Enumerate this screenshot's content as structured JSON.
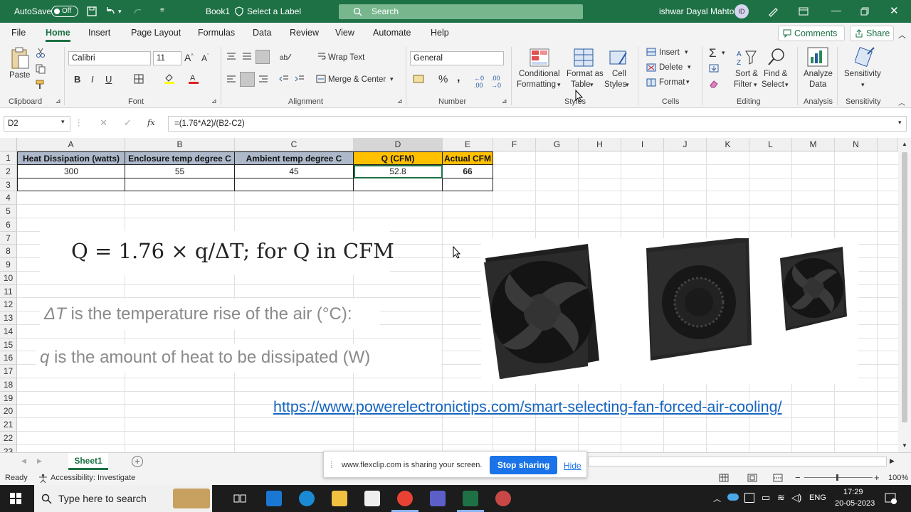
{
  "titlebar": {
    "autosave_label": "AutoSave",
    "autosave_state": "Off",
    "doc_name": "Book1",
    "label_hint": "Select a Label",
    "search_placeholder": "Search",
    "user_name": "ishwar Dayal Mahto",
    "user_initials": "ID"
  },
  "menu": {
    "tabs": [
      "File",
      "Home",
      "Insert",
      "Page Layout",
      "Formulas",
      "Data",
      "Review",
      "View",
      "Automate",
      "Help"
    ],
    "active": "Home",
    "comments": "Comments",
    "share": "Share"
  },
  "ribbon": {
    "clipboard": {
      "paste": "Paste",
      "group": "Clipboard"
    },
    "font": {
      "name": "Calibri",
      "size": "11",
      "group": "Font",
      "bold": "B",
      "italic": "I",
      "underline": "U"
    },
    "alignment": {
      "wrap": "Wrap Text",
      "merge": "Merge & Center",
      "group": "Alignment"
    },
    "number": {
      "format": "General",
      "group": "Number"
    },
    "styles": {
      "conditional": "Conditional",
      "conditional2": "Formatting",
      "format_table": "Format as",
      "format_table2": "Table",
      "cell_styles": "Cell",
      "cell_styles2": "Styles",
      "group": "Styles"
    },
    "cells": {
      "insert": "Insert",
      "delete": "Delete",
      "format": "Format",
      "group": "Cells"
    },
    "editing": {
      "sort": "Sort &",
      "sort2": "Filter",
      "find": "Find &",
      "find2": "Select",
      "group": "Editing"
    },
    "analysis": {
      "analyze": "Analyze",
      "analyze2": "Data",
      "group": "Analysis"
    },
    "sensitivity": {
      "label": "Sensitivity",
      "group": "Sensitivity"
    }
  },
  "formula_bar": {
    "name_box": "D2",
    "formula": "=(1.76*A2)/(B2-C2)",
    "fx": "fx"
  },
  "grid": {
    "columns": [
      "A",
      "B",
      "C",
      "D",
      "E",
      "F",
      "G",
      "H",
      "I",
      "J",
      "K",
      "L",
      "M",
      "N"
    ],
    "rows": [
      "1",
      "2",
      "3",
      "4",
      "5",
      "6",
      "7",
      "8",
      "9",
      "10",
      "11",
      "12",
      "13",
      "14",
      "15",
      "16",
      "17",
      "18",
      "19",
      "20",
      "21",
      "22",
      "23"
    ],
    "headers": [
      "Heat Dissipation (watts)",
      "Enclosure temp degree C",
      "Ambient temp degree C",
      "Q (CFM)",
      "Actual CFM"
    ],
    "values": [
      "300",
      "55",
      "45",
      "52.8",
      "66"
    ]
  },
  "overlay": {
    "formula": "Q = 1.76 × q/ΔT; for Q in CFM",
    "delta_sym": "ΔT",
    "delta_text": "is the temperature rise of the air (°C):",
    "q_sym": "q",
    "q_text": "is the amount of heat to be dissipated (W)",
    "link": "https://www.powerelectronictips.com/smart-selecting-fan-forced-air-cooling/"
  },
  "sheet_tabs": {
    "active": "Sheet1",
    "add": "+"
  },
  "status": {
    "ready": "Ready",
    "accessibility": "Accessibility: Investigate",
    "zoom": "100%"
  },
  "share_bar": {
    "message": "www.flexclip.com is sharing your screen.",
    "stop": "Stop sharing",
    "hide": "Hide"
  },
  "taskbar": {
    "search_placeholder": "Type here to search",
    "lang": "ENG",
    "time": "17:29",
    "date": "20-05-2023"
  },
  "colors": {
    "excel_green": "#1e7145",
    "header_blue": "#adb9ca",
    "header_orange": "#ffc000",
    "link_blue": "#1565c0",
    "share_blue": "#1a73e8"
  }
}
